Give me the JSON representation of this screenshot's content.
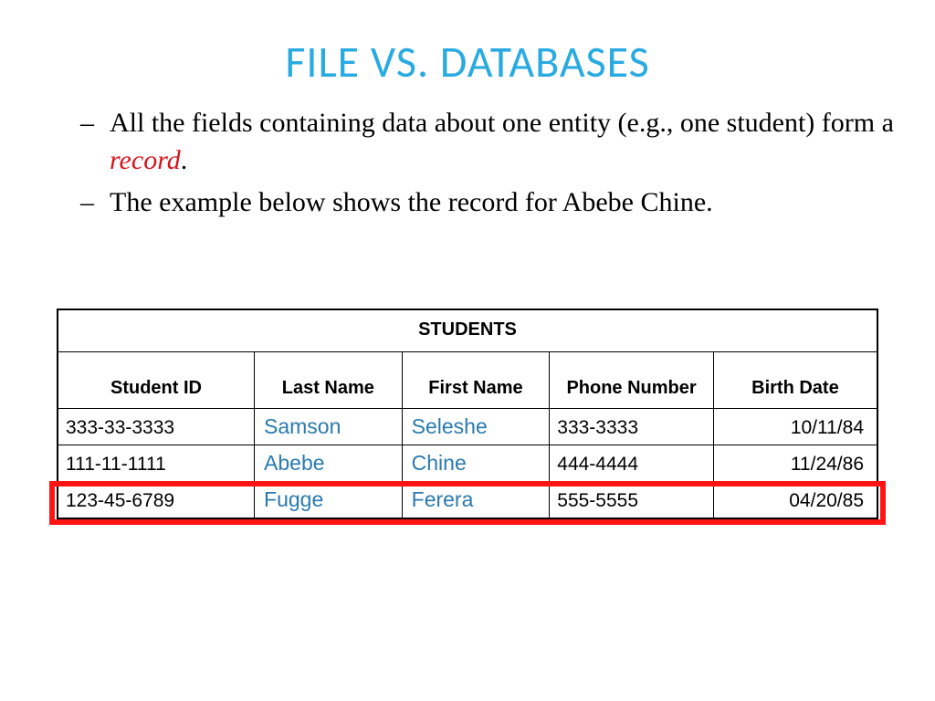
{
  "title": "FILE VS. DATABASES",
  "bullets": [
    {
      "pre": "All the fields containing data about one entity (e.g., one student) form a ",
      "em": "record",
      "post": "."
    },
    {
      "pre": "The example below shows the record for Abebe Chine.",
      "em": "",
      "post": ""
    }
  ],
  "table": {
    "caption": "STUDENTS",
    "headers": [
      "Student ID",
      "Last Name",
      "First Name",
      "Phone Number",
      "Birth Date"
    ],
    "rows": [
      {
        "id": "333-33-3333",
        "last": "Samson",
        "first": "Seleshe",
        "phone": "333-3333",
        "date": "10/11/84"
      },
      {
        "id": "111-11-1111",
        "last": "Abebe",
        "first": "Chine",
        "phone": "444-4444",
        "date": "11/24/86"
      },
      {
        "id": "123-45-6789",
        "last": "Fugge",
        "first": "Ferera",
        "phone": "555-5555",
        "date": "04/20/85"
      }
    ]
  }
}
